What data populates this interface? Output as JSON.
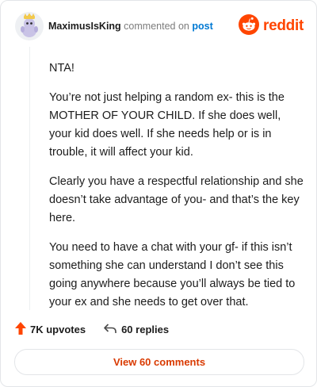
{
  "comment": {
    "author": "MaximusIsKing",
    "action": "commented on",
    "target": "post",
    "paragraphs": [
      "NTA!",
      "You’re not just helping a random ex- this is the MOTHER OF YOUR CHILD. If she does well, your kid does well. If she needs help or is in trouble, it will affect your kid.",
      "Clearly you have a respectful relationship and she doesn’t take advantage of you- and that’s the key here.",
      "You need to have a chat with your gf- if this isn’t something she can understand I don’t see this going anywhere because you’ll always be tied to your ex and she needs to get over that."
    ]
  },
  "brand": {
    "wordmark": "reddit",
    "color": "#ff4500",
    "icon": "reddit-snoo-icon"
  },
  "actions": {
    "upvotes": "7K upvotes",
    "replies": "60 replies",
    "upvote_icon": "upvote-arrow-icon",
    "reply_icon": "reply-arrow-icon",
    "upvote_color": "#ff4500"
  },
  "footer": {
    "view_comments": "View 60 comments",
    "accent": "#d93a00"
  }
}
